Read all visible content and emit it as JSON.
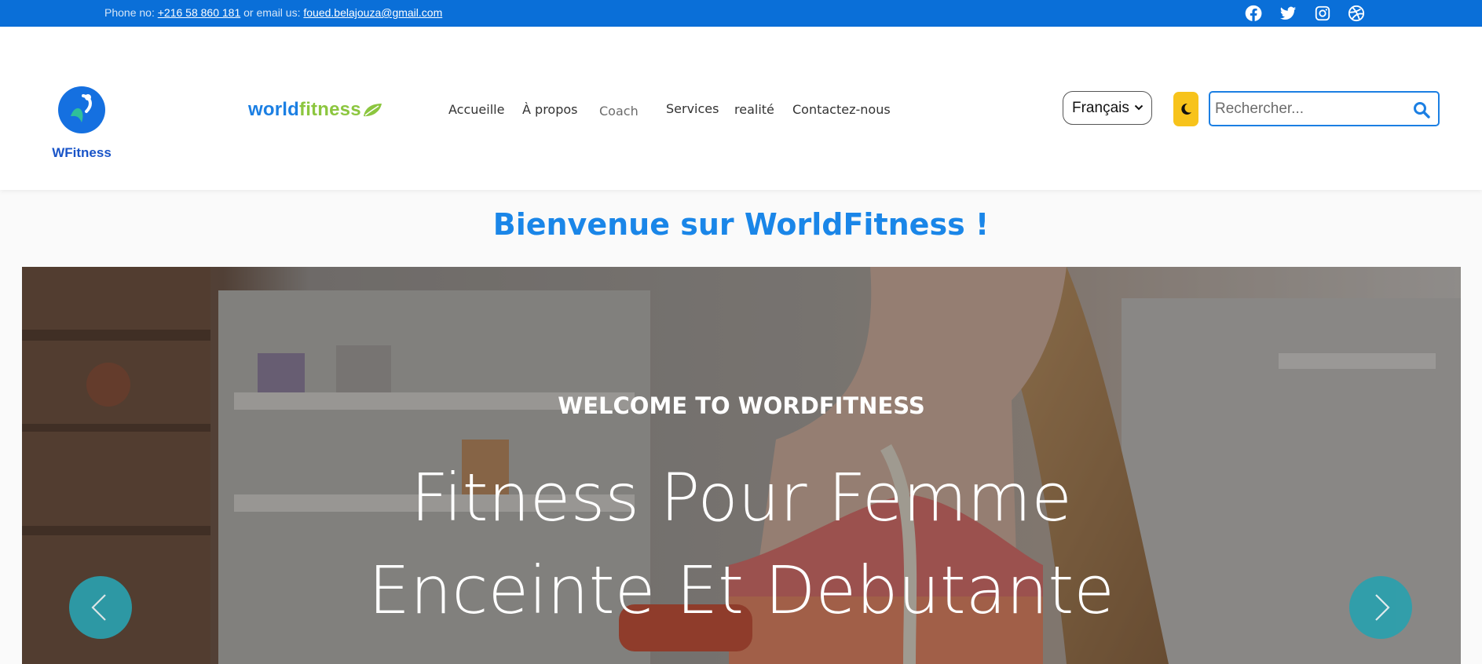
{
  "topbar": {
    "phone_prefix": "Phone no:",
    "phone": "+216 58 860 181",
    "email_prefix": "or email us:",
    "email": "foued.belajouza@gmail.com",
    "social_icons": [
      "facebook-icon",
      "twitter-icon",
      "instagram-icon",
      "dribbble-icon"
    ],
    "bg_color": "#0a6fd8"
  },
  "header": {
    "logo_text": "WFitness",
    "brand_part1": "world",
    "brand_part2": "fitness",
    "nav": [
      "Accueille",
      "À propos",
      "Coach",
      "Services",
      "realité",
      "Contactez-nous"
    ],
    "language_selected": "Français",
    "search_placeholder": "Rechercher...",
    "accent_color": "#1b7fe3",
    "dark_toggle_color": "#f7c31b"
  },
  "welcome_title": "Bienvenue sur WorldFitness !",
  "hero": {
    "kicker": "WELCOME TO WORDFITNESS",
    "headline_line1": "Fitness Pour Femme",
    "headline_line2": "Enceinte Et Debutante",
    "arrow_color": "#2aa0ae"
  }
}
